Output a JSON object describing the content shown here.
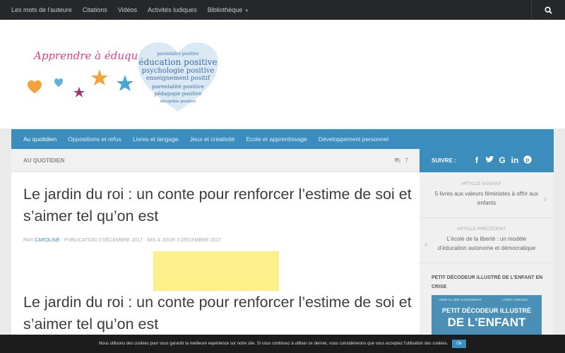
{
  "topnav": {
    "items": [
      "Les mots de l'auteure",
      "Citations",
      "Vidéos",
      "Activités ludiques",
      "Bibliothèque"
    ],
    "search_icon": "search-icon"
  },
  "logo": {
    "title": "Apprendre à éduquer",
    "heart_words": [
      "parentalité positive",
      "éducation positive",
      "psychologie positive",
      "enseignement positif",
      "parentalité positive",
      "pédagogie positive",
      "discipline positive"
    ],
    "colors": {
      "title": "#e73c8b",
      "heart": "#9fc6e4",
      "star_orange": "#f4a23a",
      "star_purple": "#a2306b",
      "star_blue": "#4aa6d9"
    }
  },
  "catnav": {
    "items": [
      "Au quotidien",
      "Oppositions et refus",
      "Livres et langage",
      "Jeux et créativité",
      "Ecole et apprentissage",
      "Développement personnel"
    ],
    "active": 0
  },
  "content": {
    "breadcrumb": "Au quotidien",
    "comment_count": "7",
    "title": "Le jardin du roi : un conte pour renforcer l’estime de soi et s’aimer tel qu’on est",
    "meta_by": "par",
    "author": "Caroline",
    "meta_rest": "· Publication 3 décembre 2017 · Mis à jour 3 décembre 2017",
    "title_repeat": "Le jardin du roi : un conte pour renforcer l’estime de soi et s’aimer tel qu’on est"
  },
  "sidebar": {
    "follow_label": "SUIVRE :",
    "social": [
      "facebook-icon",
      "twitter-icon",
      "google-icon",
      "linkedin-icon",
      "pinterest-icon"
    ],
    "next_label": "Article suivant",
    "next_title": "5 livres aux valeurs féministes à offrir aux enfants",
    "prev_label": "Article précédent",
    "prev_title": "L’école de la liberté : un modèle d’éducation autonome et démocratique",
    "widget_title": "Petit décodeur illustré de l'enfant en crise",
    "book": {
      "author1": "Anne-Claire Kleindienst",
      "author2": "Lynda Corazza",
      "line1": "Petit décodeur illustré",
      "line2": "de l'enfant"
    }
  },
  "cookie": {
    "text": "Nous utilisons des cookies pour vous garantir la meilleure expérience sur notre site. Si vous continuez à utiliser ce dernier, nous considérerons que vous acceptez l'utilisation des cookies.",
    "ok": "Ok"
  },
  "colors": {
    "accent": "#3b8dbd",
    "topnav_bg": "#26272b",
    "ad": "#fdf08a"
  }
}
